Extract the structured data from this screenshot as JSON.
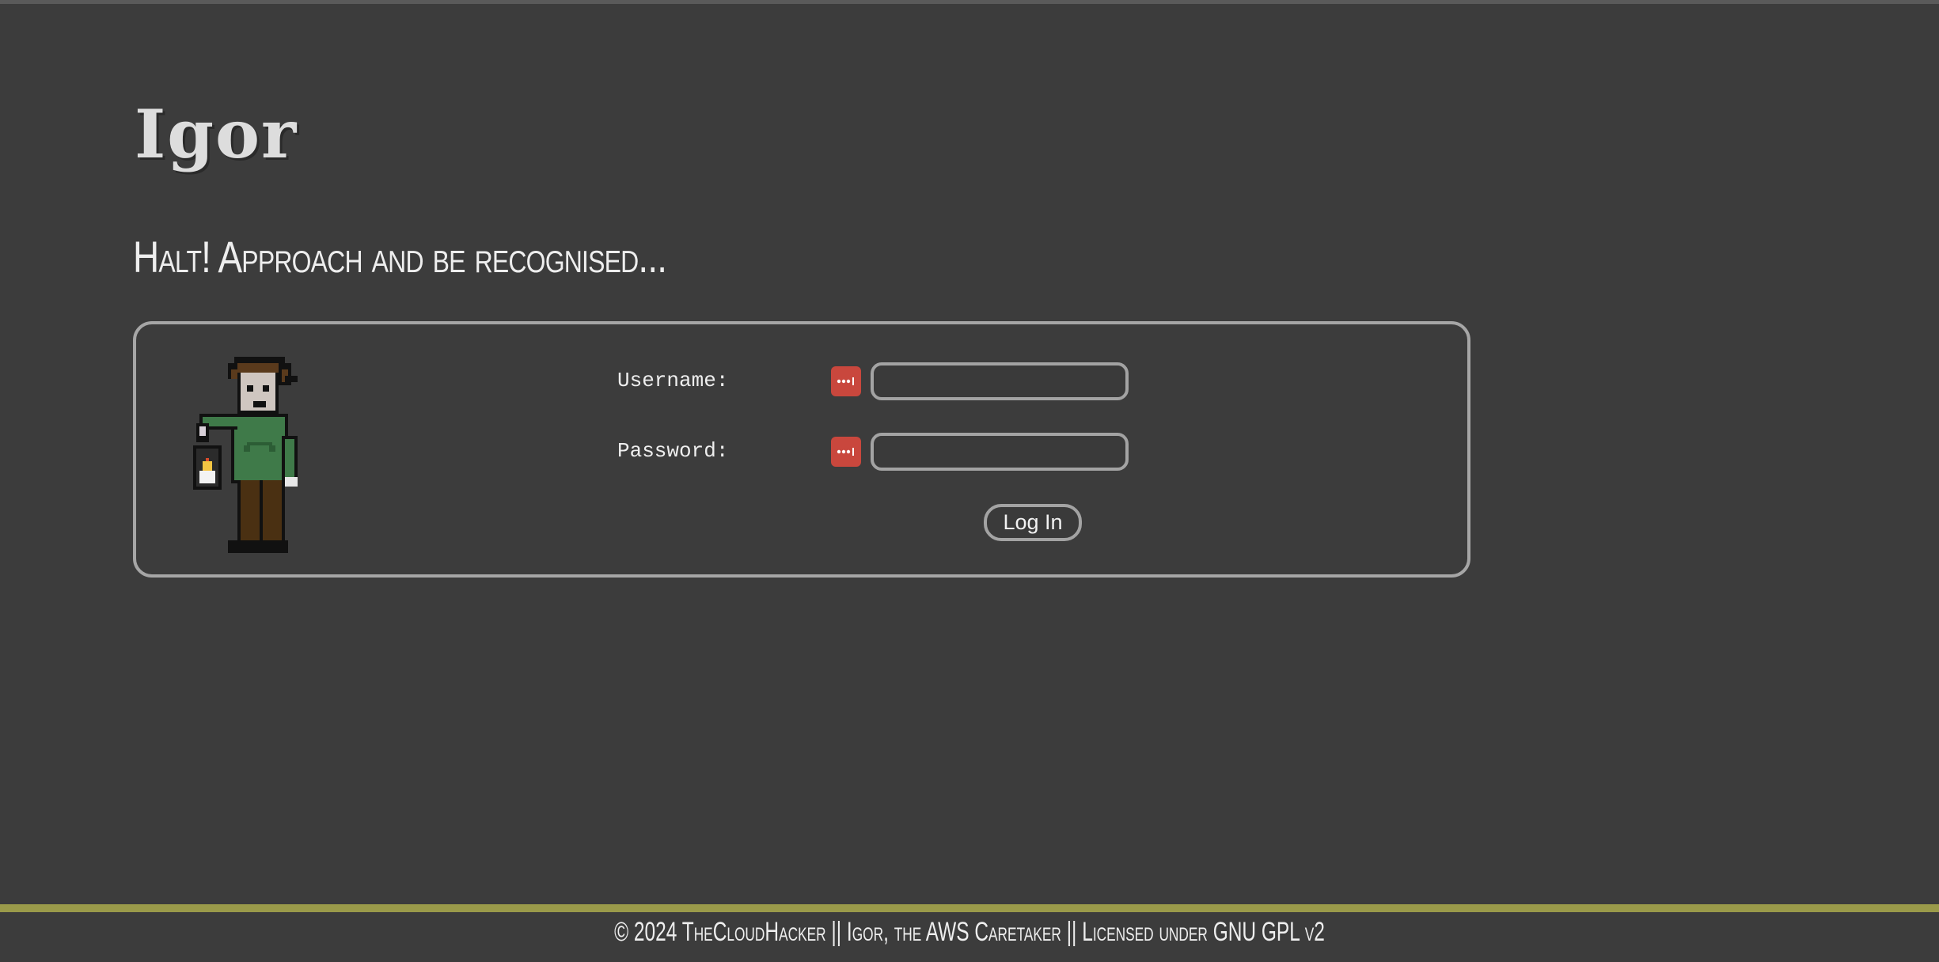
{
  "header": {
    "app_title": "Igor",
    "subtitle": "Halt! Approach and be recognised..."
  },
  "login_form": {
    "username_label": "Username:",
    "password_label": "Password:",
    "username_value": "",
    "password_value": "",
    "submit_label": "Log In",
    "password_manager_icon": "password-manager-icon",
    "password_manager_color": "#c9473d"
  },
  "footer": {
    "text": "© 2024 TheCloudHacker || Igor, the AWS Caretaker || Licensed under GNU GPL v2",
    "rule_color": "#9a9a4a"
  },
  "colors": {
    "background": "#3c3c3c",
    "border": "#a6a6a6"
  }
}
